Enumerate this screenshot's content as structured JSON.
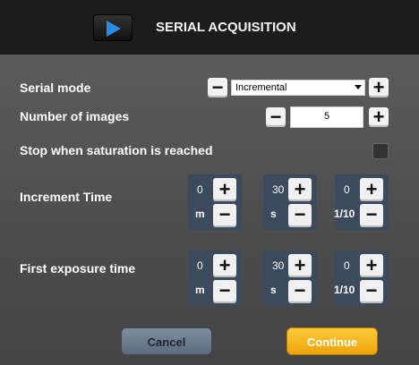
{
  "dialog": {
    "title": "SERIAL ACQUISITION"
  },
  "serial_mode": {
    "label": "Serial mode",
    "value": "Incremental"
  },
  "number_of_images": {
    "label": "Number of images",
    "value": "5"
  },
  "stop_saturation": {
    "label": "Stop when saturation is reached",
    "checked": false
  },
  "increment_time": {
    "label": "Increment Time",
    "minutes": {
      "value": "0",
      "unit": "m"
    },
    "seconds": {
      "value": "30",
      "unit": "s"
    },
    "tenths": {
      "value": "0",
      "unit": "1/10"
    }
  },
  "first_exposure_time": {
    "label": "First exposure time",
    "minutes": {
      "value": "0",
      "unit": "m"
    },
    "seconds": {
      "value": "30",
      "unit": "s"
    },
    "tenths": {
      "value": "0",
      "unit": "1/10"
    }
  },
  "buttons": {
    "plus": "+",
    "minus": "−",
    "cancel": "Cancel",
    "continue": "Continue"
  }
}
